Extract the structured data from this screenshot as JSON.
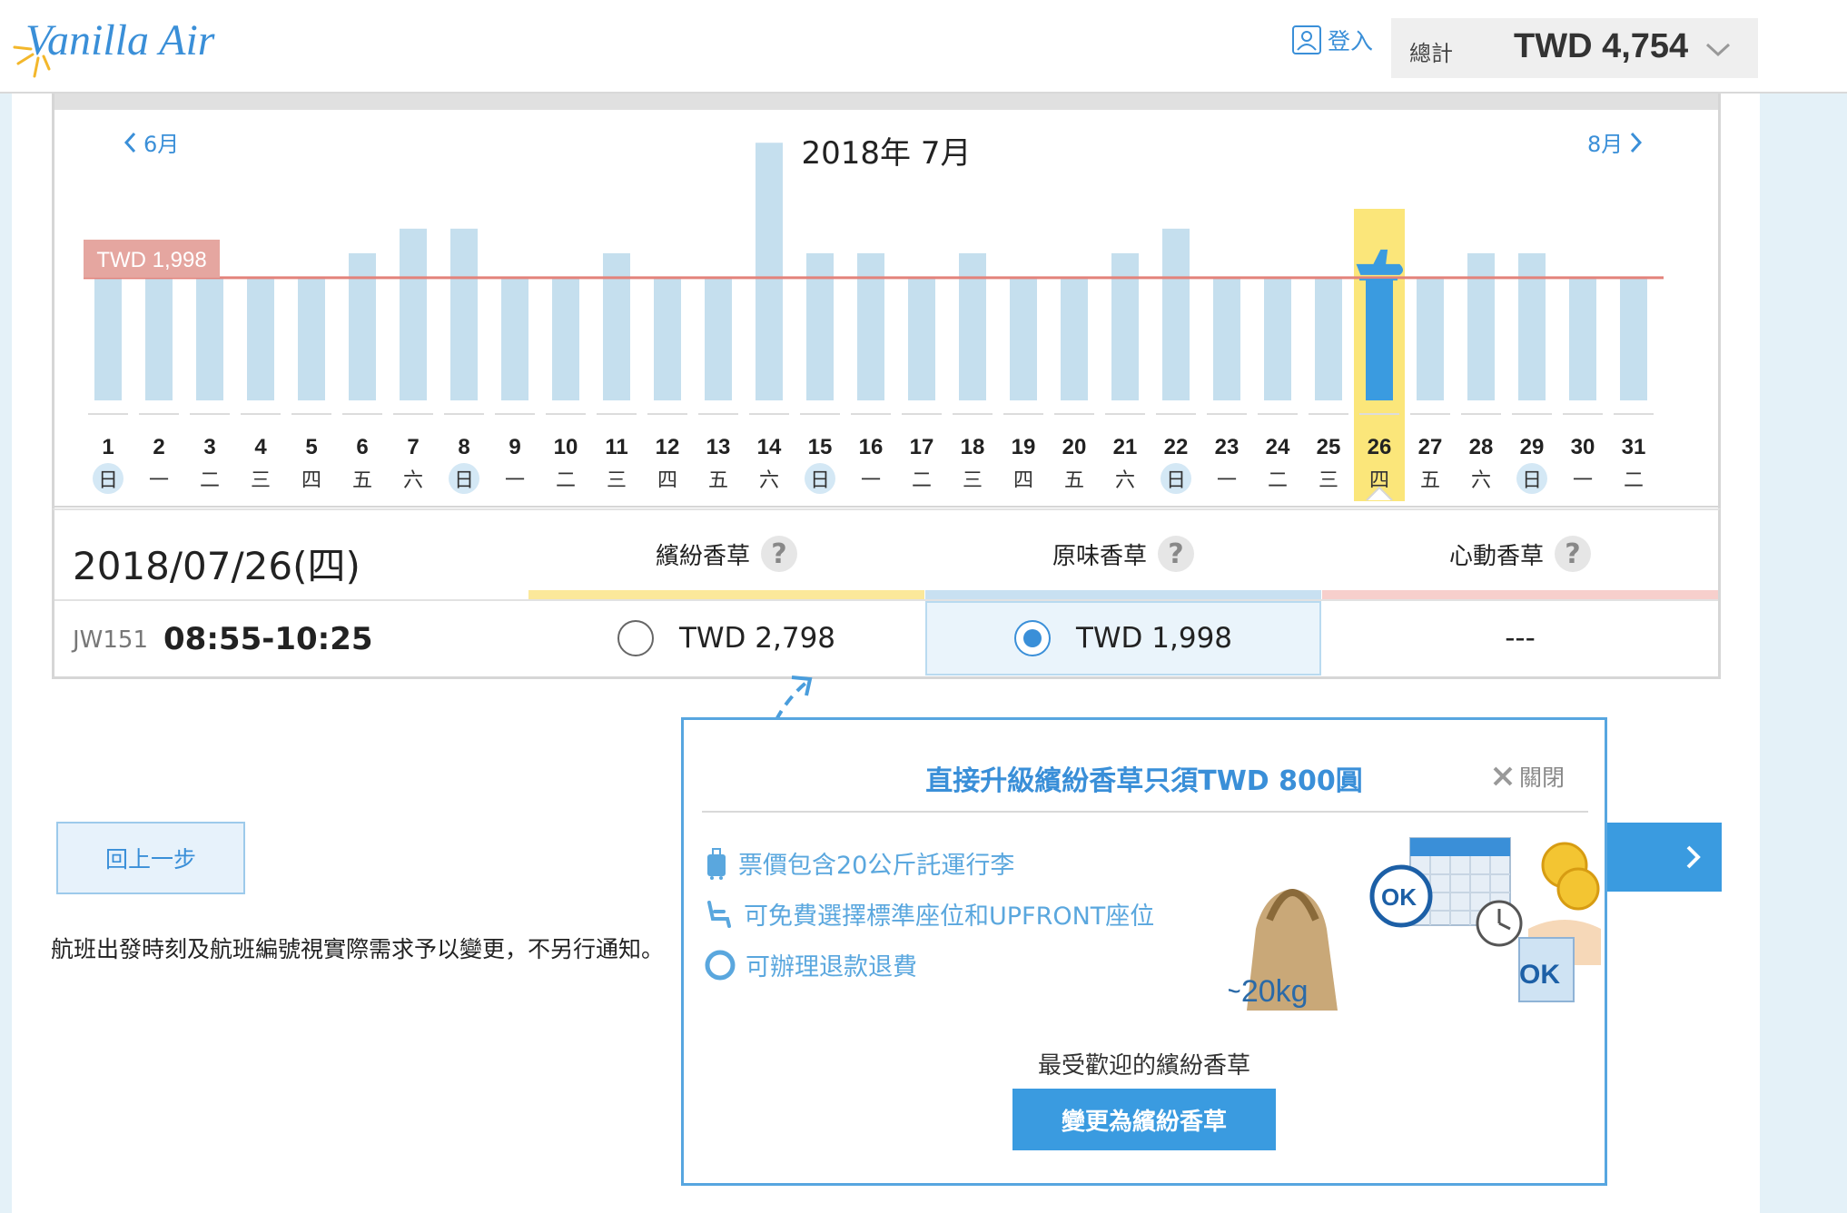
{
  "header": {
    "logo_text": "Vanilla Air",
    "login_label": "登入",
    "total_label": "總計",
    "total_value": "TWD 4,754"
  },
  "calendar": {
    "prev_month": "6月",
    "next_month": "8月",
    "title": "2018年 7月",
    "lowest_price_label": "TWD 1,998"
  },
  "chart_data": {
    "type": "bar",
    "title": "2018年 7月",
    "categories": [
      "1",
      "2",
      "3",
      "4",
      "5",
      "6",
      "7",
      "8",
      "9",
      "10",
      "11",
      "12",
      "13",
      "14",
      "15",
      "16",
      "17",
      "18",
      "19",
      "20",
      "21",
      "22",
      "23",
      "24",
      "25",
      "26",
      "27",
      "28",
      "29",
      "30",
      "31"
    ],
    "weekdays": [
      "日",
      "一",
      "二",
      "三",
      "四",
      "五",
      "六",
      "日",
      "一",
      "二",
      "三",
      "四",
      "五",
      "六",
      "日",
      "一",
      "二",
      "三",
      "四",
      "五",
      "六",
      "日",
      "一",
      "二",
      "三",
      "四",
      "五",
      "六",
      "日",
      "一",
      "二"
    ],
    "values": [
      1998,
      1998,
      1998,
      1998,
      1998,
      2398,
      2798,
      2798,
      1998,
      1998,
      2398,
      1998,
      1998,
      4198,
      2398,
      2398,
      1998,
      2398,
      1998,
      1998,
      2398,
      2798,
      1998,
      1998,
      1998,
      1998,
      1998,
      2398,
      2398,
      1998,
      1998
    ],
    "reference_line": 1998,
    "selected_day": "26",
    "ylim": [
      0,
      5000
    ],
    "colors": {
      "bar": "#c5dfee",
      "selected_bar": "#3a9be0",
      "highlight": "#fbe67a",
      "reference_line": "#e3827a",
      "sunday_circle": "#d4e8f5"
    }
  },
  "fare_table": {
    "date": "2018/07/26(四)",
    "columns": [
      {
        "name": "繽紛香草",
        "help": "?",
        "color": "#fbe89a"
      },
      {
        "name": "原味香草",
        "help": "?",
        "color": "#c8e0f1"
      },
      {
        "name": "心動香草",
        "help": "?",
        "color": "#f7cfcc"
      }
    ],
    "row": {
      "flight_no": "JW151",
      "time": "08:55-10:25",
      "fares": [
        "TWD 2,798",
        "TWD 1,998",
        "---"
      ],
      "selected_index": 1
    }
  },
  "footer": {
    "back_label": "回上一步",
    "notice": "航班出發時刻及航班編號視實際需求予以變更，不另行通知。"
  },
  "popup": {
    "title": "直接升級繽紛香草只須TWD 800圓",
    "close_label": "關閉",
    "benefits": [
      "票價包含20公斤託運行李",
      "可免費選擇標準座位和UPFRONT座位",
      "可辦理退款退費"
    ],
    "popular_label": "最受歡迎的繽紛香草",
    "change_label": "變更為繽紛香草",
    "illustration_labels": [
      "~20kg",
      "OK",
      "OK"
    ]
  }
}
